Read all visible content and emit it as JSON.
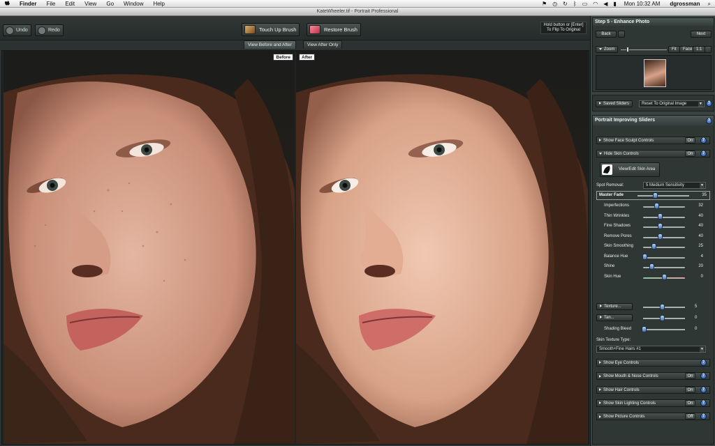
{
  "menubar": {
    "apple": "",
    "app": "Finder",
    "items": [
      "File",
      "Edit",
      "View",
      "Go",
      "Window",
      "Help"
    ],
    "clock": "Mon 10:32 AM",
    "user": "dgrossman",
    "status_icons": [
      "battery",
      "volume",
      "wifi",
      "sync",
      "bluetooth",
      "display",
      "time-machine",
      "flag"
    ]
  },
  "window": {
    "title": "KateWheeler.tif - Portrait Professional"
  },
  "toolbar": {
    "undo": "Undo",
    "redo": "Redo",
    "touch_up": "Touch Up Brush",
    "restore": "Restore Brush",
    "hint": "Hold button or [Enter] To Flip To Original"
  },
  "view_tabs": [
    "View Before and After",
    "View After Only"
  ],
  "panes": {
    "before": "Before",
    "after": "After"
  },
  "sidebar": {
    "step_title": "Step 5 - Enhance Photo",
    "back": "Back",
    "next": "Next",
    "zoom_label": "Zoom",
    "zoom_fit": "Fit",
    "zoom_face": "Face",
    "zoom_11": "1:1",
    "saved_sliders": "Saved Sliders",
    "reset_dropdown": "Reset To Original Image",
    "portrait_title": "Portrait Improving Sliders",
    "face_sculpt": "Show Face Sculpt Controls",
    "face_sculpt_state": "On",
    "hide_skin": "Hide Skin Controls",
    "hide_skin_state": "On",
    "view_edit_skin": "View/Edit Skin Area",
    "spot_removal_label": "Spot Removal:",
    "spot_removal_value": "5 Medium Sensitivity",
    "master_fade_label": "Master Fade",
    "master_fade_value": "35",
    "sliders": [
      {
        "label": "Imperfections",
        "value": "32",
        "pos": 0.32
      },
      {
        "label": "Thin Wrinkles",
        "value": "40",
        "pos": 0.4
      },
      {
        "label": "Fine Shadows",
        "value": "40",
        "pos": 0.4
      },
      {
        "label": "Remove Pores",
        "value": "40",
        "pos": 0.4
      },
      {
        "label": "Skin Smoothing",
        "value": "25",
        "pos": 0.25
      },
      {
        "label": "Balance Hue",
        "value": "4",
        "pos": 0.04
      },
      {
        "label": "Shine",
        "value": "20",
        "pos": 0.2
      },
      {
        "label": "Skin Hue",
        "value": "0",
        "pos": 0.5
      }
    ],
    "texture_label": "Texture...",
    "texture_value": "5",
    "tan_label": "Tan...",
    "tan_value": "0",
    "shading_bleed_label": "Shading Bleed",
    "shading_bleed_value": "0",
    "skin_texture_type_label": "Skin Texture Type:",
    "skin_texture_type_value": "Smooth+Fine Hairs #1",
    "sections": [
      {
        "label": "Show Eye Controls",
        "state": ""
      },
      {
        "label": "Show Mouth & Nose Controls",
        "state": "On"
      },
      {
        "label": "Show Hair Controls",
        "state": "On"
      },
      {
        "label": "Show Skin Lighting Controls",
        "state": "On"
      },
      {
        "label": "Show Picture Controls",
        "state": "Off"
      }
    ]
  },
  "colors": {
    "accent": "#4a78b8",
    "panel": "#2f3735",
    "sidebar": "#3a4341"
  }
}
